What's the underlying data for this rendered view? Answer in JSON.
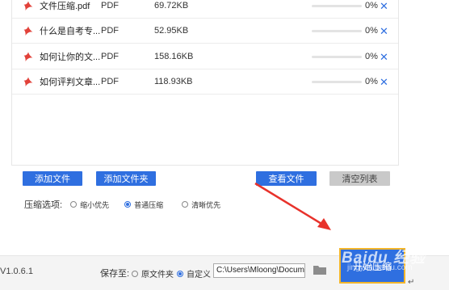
{
  "files": [
    {
      "name": "文件压缩.pdf",
      "type": "PDF",
      "size": "69.72KB",
      "progress": 0,
      "percent_label": "0%"
    },
    {
      "name": "什么是自考专...",
      "type": "PDF",
      "size": "52.95KB",
      "progress": 0,
      "percent_label": "0%"
    },
    {
      "name": "如何让你的文...",
      "type": "PDF",
      "size": "158.16KB",
      "progress": 0,
      "percent_label": "0%"
    },
    {
      "name": "如何评判文章...",
      "type": "PDF",
      "size": "118.93KB",
      "progress": 0,
      "percent_label": "0%"
    }
  ],
  "remove_glyph": "✕",
  "buttons": {
    "add_file": "添加文件",
    "add_folder": "添加文件夹",
    "view_files": "查看文件",
    "clear_list": "清空列表",
    "start": "开始压缩"
  },
  "compression": {
    "label": "压缩选项:",
    "options": [
      {
        "label": "缩小优先",
        "checked": false
      },
      {
        "label": "普通压缩",
        "checked": true
      },
      {
        "label": "清晰优先",
        "checked": false
      }
    ]
  },
  "footer": {
    "version": "V1.0.6.1",
    "save_to_label": "保存至:",
    "save_options": [
      {
        "label": "原文件夹",
        "checked": false
      },
      {
        "label": "自定义",
        "checked": true
      }
    ],
    "path_value": "C:\\Users\\Mloong\\Docume"
  },
  "watermark": {
    "text": "Baidu 经验",
    "sub": "jingyan.baidu.com"
  },
  "colors": {
    "accent": "#2f6fe0",
    "pdf_red": "#e2423a",
    "highlight_border": "#f3b62b",
    "arrow": "#e8322b"
  },
  "icons": {
    "pdf": "pdf-icon",
    "folder": "folder-icon",
    "remove": "close-icon"
  }
}
